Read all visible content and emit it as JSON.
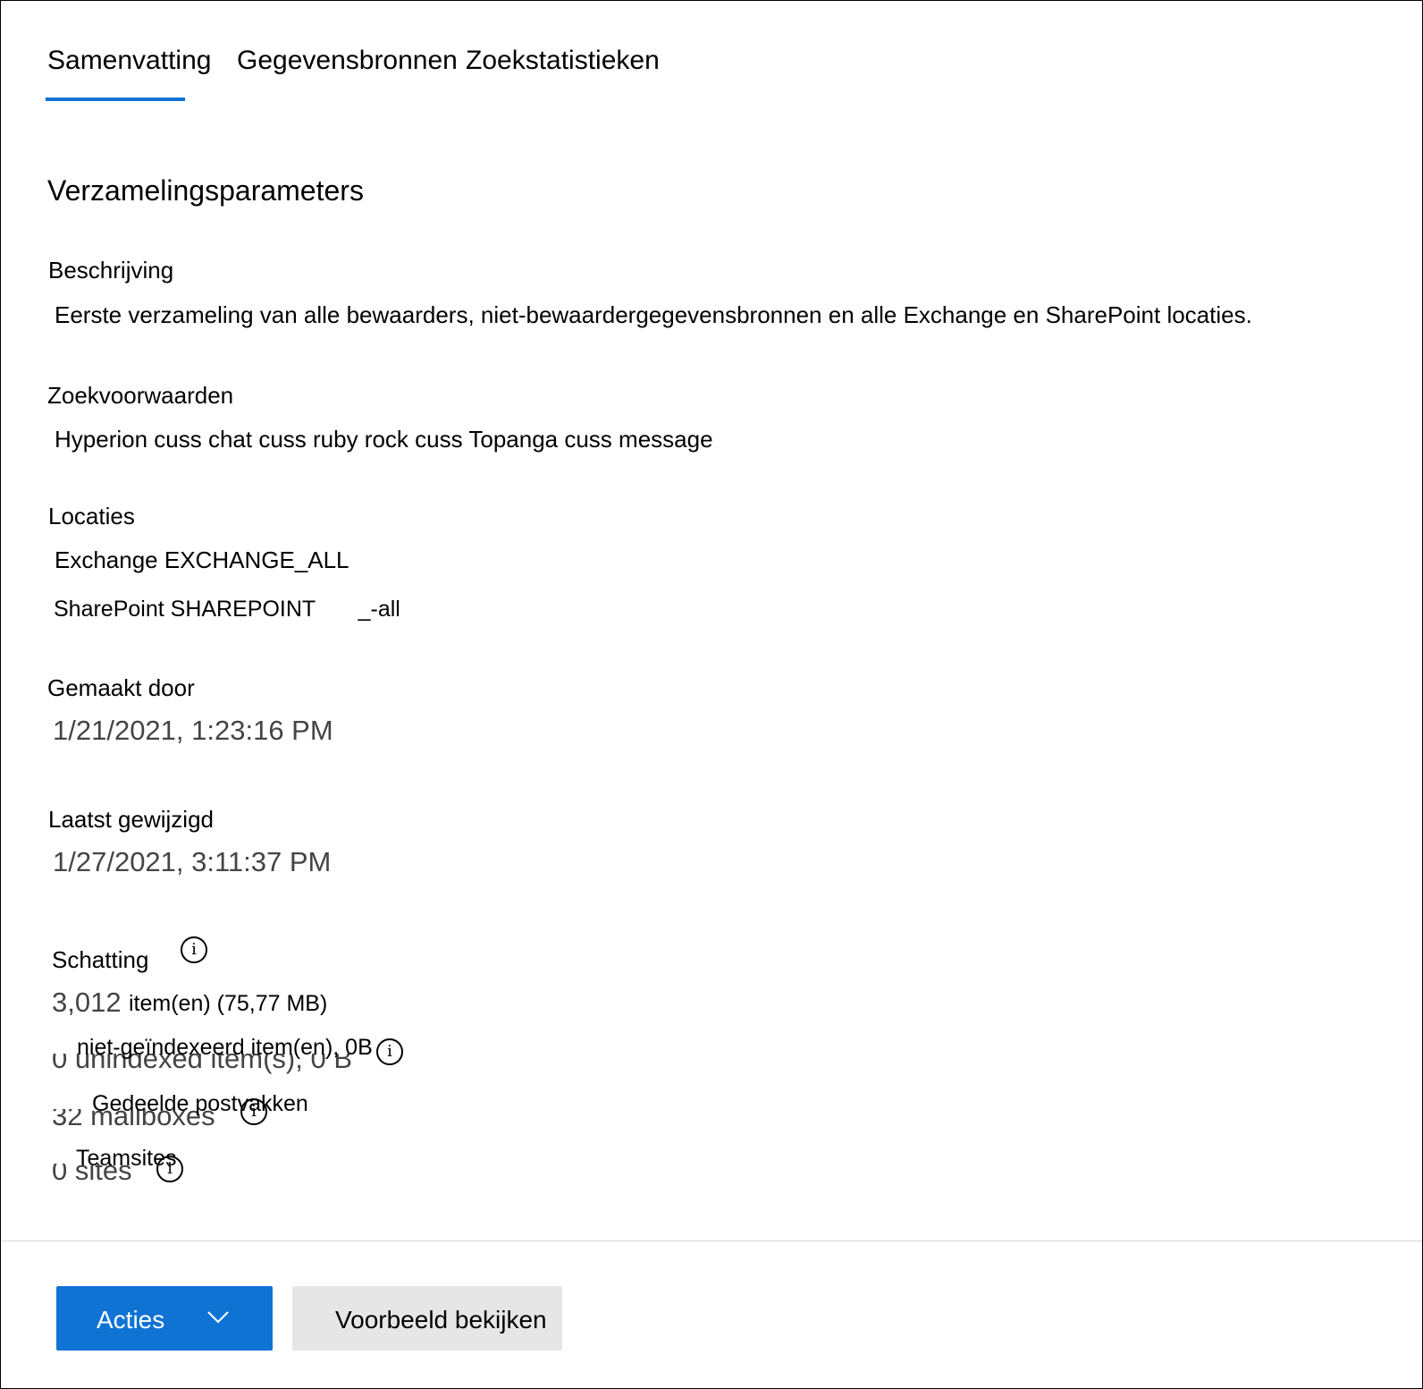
{
  "tabs": [
    {
      "label": "Samenvatting",
      "active": true
    },
    {
      "label": "Gegevensbronnen",
      "active": false
    },
    {
      "label": "Zoekstatistieken",
      "active": false
    }
  ],
  "section_title": "Verzamelingsparameters",
  "description": {
    "label": "Beschrijving",
    "value": "Eerste verzameling van alle bewaarders, niet-bewaardergegevensbronnen en alle Exchange en SharePoint locaties."
  },
  "query": {
    "label": "Zoekvoorwaarden",
    "value": "Hyperion cuss chat cuss ruby rock cuss Topanga cuss message"
  },
  "locations": {
    "label": "Locaties",
    "exchange": "Exchange EXCHANGE_ALL",
    "sharepoint_prefix": "SharePoint SHAREPOINT",
    "sharepoint_suffix": "_-all"
  },
  "created": {
    "label": "Gemaakt door",
    "value": "1/21/2021, 1:23:16 PM"
  },
  "modified": {
    "label": "Laatst gewijzigd",
    "value": "1/27/2021, 3:11:37 PM"
  },
  "estimate": {
    "label": "Schatting",
    "items_count": "3,012",
    "items_text": "item(en) (75,77 MB)",
    "unindexed_ghost": "0 unindexed item(s), 0 B",
    "unindexed_text": "niet-geïndexeerd item(en), 0B",
    "mailboxes_ghost": "32 mailboxes",
    "mailboxes_text": "Gedeelde postvakken",
    "sites_ghost": "0 sites",
    "sites_text": "Teamsites",
    "info_glyph": "i"
  },
  "actions": {
    "primary_label": "Acties",
    "secondary_label": "Voorbeeld bekijken"
  },
  "colors": {
    "accent": "#0f73d3",
    "secondary_button_bg": "#e6e6e6",
    "date_text": "#444444"
  }
}
